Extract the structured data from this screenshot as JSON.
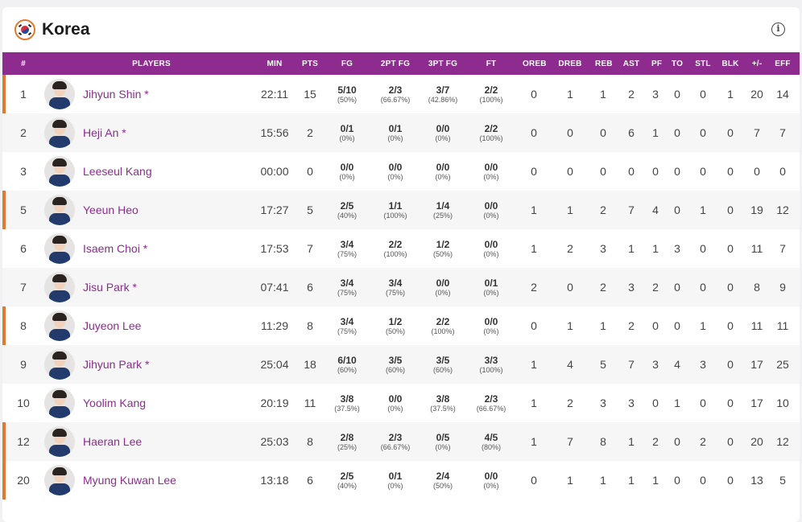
{
  "team": {
    "name": "Korea",
    "flag_icon": "korea-flag-icon",
    "info_icon": "info-icon",
    "accent": "#e07a2e",
    "header_bg": "#8e2b8f"
  },
  "columns": [
    "#",
    "PLAYERS",
    "MIN",
    "PTS",
    "FG",
    "2PT FG",
    "3PT FG",
    "FT",
    "OREB",
    "DREB",
    "REB",
    "AST",
    "PF",
    "TO",
    "STL",
    "BLK",
    "+/-",
    "EFF"
  ],
  "players": [
    {
      "num": "1",
      "name": "Jihyun Shin *",
      "starter": true,
      "min": "22:11",
      "pts": "15",
      "fg": "5/10",
      "fg_pct": "(50%)",
      "fg2": "2/3",
      "fg2_pct": "(66.67%)",
      "fg3": "3/7",
      "fg3_pct": "(42.86%)",
      "ft": "2/2",
      "ft_pct": "(100%)",
      "oreb": "0",
      "dreb": "1",
      "reb": "1",
      "ast": "2",
      "pf": "3",
      "to": "0",
      "stl": "0",
      "blk": "1",
      "pm": "20",
      "eff": "14"
    },
    {
      "num": "2",
      "name": "Heji An *",
      "starter": false,
      "min": "15:56",
      "pts": "2",
      "fg": "0/1",
      "fg_pct": "(0%)",
      "fg2": "0/1",
      "fg2_pct": "(0%)",
      "fg3": "0/0",
      "fg3_pct": "(0%)",
      "ft": "2/2",
      "ft_pct": "(100%)",
      "oreb": "0",
      "dreb": "0",
      "reb": "0",
      "ast": "6",
      "pf": "1",
      "to": "0",
      "stl": "0",
      "blk": "0",
      "pm": "7",
      "eff": "7"
    },
    {
      "num": "3",
      "name": "Leeseul Kang",
      "starter": false,
      "min": "00:00",
      "pts": "0",
      "fg": "0/0",
      "fg_pct": "(0%)",
      "fg2": "0/0",
      "fg2_pct": "(0%)",
      "fg3": "0/0",
      "fg3_pct": "(0%)",
      "ft": "0/0",
      "ft_pct": "(0%)",
      "oreb": "0",
      "dreb": "0",
      "reb": "0",
      "ast": "0",
      "pf": "0",
      "to": "0",
      "stl": "0",
      "blk": "0",
      "pm": "0",
      "eff": "0"
    },
    {
      "num": "5",
      "name": "Yeeun Heo",
      "starter": true,
      "min": "17:27",
      "pts": "5",
      "fg": "2/5",
      "fg_pct": "(40%)",
      "fg2": "1/1",
      "fg2_pct": "(100%)",
      "fg3": "1/4",
      "fg3_pct": "(25%)",
      "ft": "0/0",
      "ft_pct": "(0%)",
      "oreb": "1",
      "dreb": "1",
      "reb": "2",
      "ast": "7",
      "pf": "4",
      "to": "0",
      "stl": "1",
      "blk": "0",
      "pm": "19",
      "eff": "12"
    },
    {
      "num": "6",
      "name": "Isaem Choi *",
      "starter": false,
      "min": "17:53",
      "pts": "7",
      "fg": "3/4",
      "fg_pct": "(75%)",
      "fg2": "2/2",
      "fg2_pct": "(100%)",
      "fg3": "1/2",
      "fg3_pct": "(50%)",
      "ft": "0/0",
      "ft_pct": "(0%)",
      "oreb": "1",
      "dreb": "2",
      "reb": "3",
      "ast": "1",
      "pf": "1",
      "to": "3",
      "stl": "0",
      "blk": "0",
      "pm": "11",
      "eff": "7"
    },
    {
      "num": "7",
      "name": "Jisu Park *",
      "starter": false,
      "min": "07:41",
      "pts": "6",
      "fg": "3/4",
      "fg_pct": "(75%)",
      "fg2": "3/4",
      "fg2_pct": "(75%)",
      "fg3": "0/0",
      "fg3_pct": "(0%)",
      "ft": "0/1",
      "ft_pct": "(0%)",
      "oreb": "2",
      "dreb": "0",
      "reb": "2",
      "ast": "3",
      "pf": "2",
      "to": "0",
      "stl": "0",
      "blk": "0",
      "pm": "8",
      "eff": "9"
    },
    {
      "num": "8",
      "name": "Juyeon Lee",
      "starter": true,
      "min": "11:29",
      "pts": "8",
      "fg": "3/4",
      "fg_pct": "(75%)",
      "fg2": "1/2",
      "fg2_pct": "(50%)",
      "fg3": "2/2",
      "fg3_pct": "(100%)",
      "ft": "0/0",
      "ft_pct": "(0%)",
      "oreb": "0",
      "dreb": "1",
      "reb": "1",
      "ast": "2",
      "pf": "0",
      "to": "0",
      "stl": "1",
      "blk": "0",
      "pm": "11",
      "eff": "11"
    },
    {
      "num": "9",
      "name": "Jihyun Park *",
      "starter": false,
      "min": "25:04",
      "pts": "18",
      "fg": "6/10",
      "fg_pct": "(60%)",
      "fg2": "3/5",
      "fg2_pct": "(60%)",
      "fg3": "3/5",
      "fg3_pct": "(60%)",
      "ft": "3/3",
      "ft_pct": "(100%)",
      "oreb": "1",
      "dreb": "4",
      "reb": "5",
      "ast": "7",
      "pf": "3",
      "to": "4",
      "stl": "3",
      "blk": "0",
      "pm": "17",
      "eff": "25"
    },
    {
      "num": "10",
      "name": "Yoolim Kang",
      "starter": false,
      "min": "20:19",
      "pts": "11",
      "fg": "3/8",
      "fg_pct": "(37.5%)",
      "fg2": "0/0",
      "fg2_pct": "(0%)",
      "fg3": "3/8",
      "fg3_pct": "(37.5%)",
      "ft": "2/3",
      "ft_pct": "(66.67%)",
      "oreb": "1",
      "dreb": "2",
      "reb": "3",
      "ast": "3",
      "pf": "0",
      "to": "1",
      "stl": "0",
      "blk": "0",
      "pm": "17",
      "eff": "10"
    },
    {
      "num": "12",
      "name": "Haeran Lee",
      "starter": true,
      "min": "25:03",
      "pts": "8",
      "fg": "2/8",
      "fg_pct": "(25%)",
      "fg2": "2/3",
      "fg2_pct": "(66.67%)",
      "fg3": "0/5",
      "fg3_pct": "(0%)",
      "ft": "4/5",
      "ft_pct": "(80%)",
      "oreb": "1",
      "dreb": "7",
      "reb": "8",
      "ast": "1",
      "pf": "2",
      "to": "0",
      "stl": "2",
      "blk": "0",
      "pm": "20",
      "eff": "12"
    },
    {
      "num": "20",
      "name": "Myung Kuwan Lee",
      "starter": true,
      "min": "13:18",
      "pts": "6",
      "fg": "2/5",
      "fg_pct": "(40%)",
      "fg2": "0/1",
      "fg2_pct": "(0%)",
      "fg3": "2/4",
      "fg3_pct": "(50%)",
      "ft": "0/0",
      "ft_pct": "(0%)",
      "oreb": "0",
      "dreb": "1",
      "reb": "1",
      "ast": "1",
      "pf": "1",
      "to": "0",
      "stl": "0",
      "blk": "0",
      "pm": "13",
      "eff": "5"
    }
  ]
}
